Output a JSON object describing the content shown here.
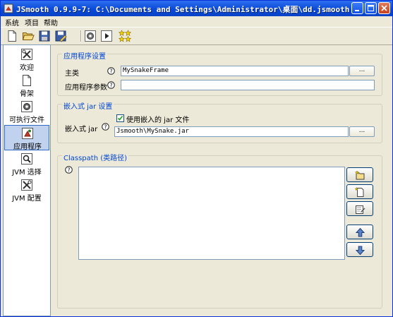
{
  "window": {
    "title": "JSmooth 0.9.9-7: C:\\Documents and Settings\\Administrator\\桌面\\dd.jsmooth"
  },
  "menu": {
    "items": [
      "系统",
      "项目",
      "帮助"
    ]
  },
  "toolbar": {
    "icons": [
      "new-file-icon",
      "open-folder-icon",
      "save-icon",
      "save-as-icon",
      "compile-gear-icon",
      "run-icon",
      "stars-icon"
    ]
  },
  "sidebar": {
    "items": [
      {
        "label": "欢迎",
        "icon": "tools-icon"
      },
      {
        "label": "骨架",
        "icon": "page-icon"
      },
      {
        "label": "可执行文件",
        "icon": "gear-page-icon"
      },
      {
        "label": "应用程序",
        "icon": "app-icon",
        "selected": true
      },
      {
        "label": "JVM 选择",
        "icon": "magnifier-icon"
      },
      {
        "label": "JVM 配置",
        "icon": "tools-icon"
      }
    ]
  },
  "app_settings": {
    "title": "应用程序设置",
    "main_class_label": "主类",
    "main_class_value": "MySnakeFrame",
    "args_label": "应用程序参数",
    "args_value": "",
    "browse_label": "..."
  },
  "embedded_jar": {
    "title": "嵌入式 jar 设置",
    "jar_label": "嵌入式 jar",
    "use_checkbox_label": "使用嵌入的 jar 文件",
    "use_checked": true,
    "jar_value": "Jsmooth\\MySnake.jar",
    "browse_label": "..."
  },
  "classpath": {
    "title": "Classpath (类路径)",
    "entries": [],
    "buttons": [
      "add-folder-icon",
      "add-file-icon",
      "edit-icon",
      "up-arrow-icon",
      "down-arrow-icon"
    ]
  },
  "colors": {
    "title_blue": "#0a4ad8",
    "group_title": "#0046d5",
    "background": "#ece9d8",
    "selection": "#c1d2ee"
  }
}
